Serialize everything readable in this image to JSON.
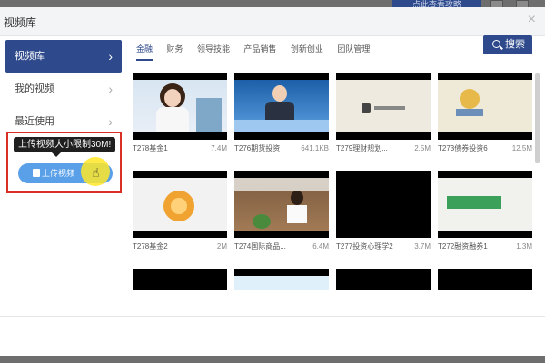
{
  "background": {
    "badge_text": "点此查看攻略"
  },
  "modal": {
    "title": "视频库",
    "close_glyph": "×"
  },
  "sidebar": {
    "items": [
      {
        "label": "视频库",
        "active": true
      },
      {
        "label": "我的视频",
        "active": false
      },
      {
        "label": "最近使用",
        "active": false
      }
    ]
  },
  "upload": {
    "tooltip": "上传视频大小限制30M!",
    "button_label": "上传视频"
  },
  "tabs": [
    {
      "label": "金融",
      "active": true
    },
    {
      "label": "财务",
      "active": false
    },
    {
      "label": "领导技能",
      "active": false
    },
    {
      "label": "产品销售",
      "active": false
    },
    {
      "label": "创新创业",
      "active": false
    },
    {
      "label": "团队管理",
      "active": false
    }
  ],
  "search": {
    "label": "搜索"
  },
  "videos": [
    {
      "name": "T278基金1",
      "size": "7.4M",
      "thumb": "woman-office"
    },
    {
      "name": "T276期货投资",
      "size": "641.1KB",
      "thumb": "man-studio"
    },
    {
      "name": "T279理财规划...",
      "size": "2.5M",
      "thumb": "finance-plan"
    },
    {
      "name": "T273债券投资6",
      "size": "12.5M",
      "thumb": "bond-coins"
    },
    {
      "name": "T278基金2",
      "size": "2M",
      "thumb": "coin-badge"
    },
    {
      "name": "T274国际商品...",
      "size": "6.4M",
      "thumb": "office-woman-desk"
    },
    {
      "name": "T277投资心理学2",
      "size": "3.7M",
      "thumb": "black"
    },
    {
      "name": "T272融资融券1",
      "size": "1.3M",
      "thumb": "green-banner"
    },
    {
      "name": "",
      "size": "",
      "thumb": "black"
    },
    {
      "name": "",
      "size": "",
      "thumb": "light-blue"
    },
    {
      "name": "",
      "size": "",
      "thumb": "black"
    },
    {
      "name": "",
      "size": "",
      "thumb": "black"
    }
  ],
  "colors": {
    "primary": "#2e4a8c",
    "highlight": "#d93025",
    "upload": "#5aa0e8"
  }
}
